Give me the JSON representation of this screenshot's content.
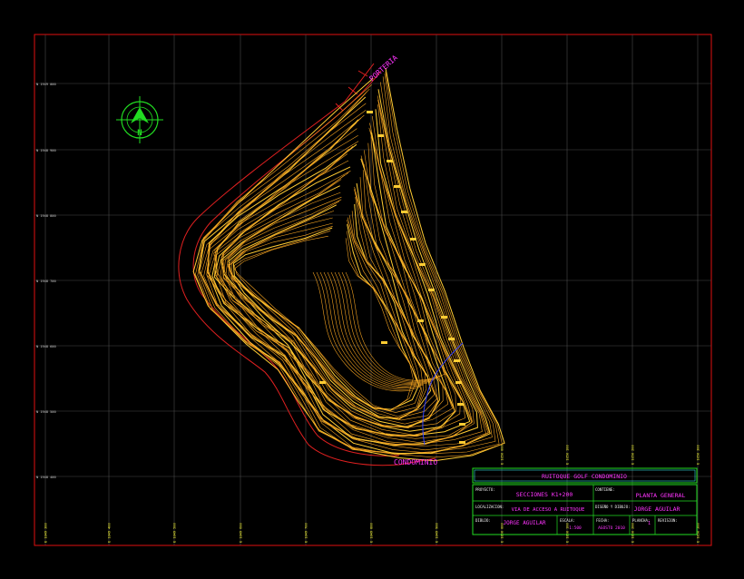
{
  "north_arrow": {
    "label": "N"
  },
  "grid_labels": {
    "left": [
      "N 1949 000",
      "N 1948 900",
      "N 1948 800",
      "N 1948 700",
      "N 1948 600",
      "N 1948 500",
      "N 1948 400"
    ],
    "bottom": [
      "E 1049 300",
      "E 1049 400",
      "E 1049 500",
      "E 1049 600",
      "E 1049 700",
      "E 1049 800",
      "E 1049 900",
      "E 1050 000",
      "E 1050 100",
      "E 1050 200",
      "E 1050 300"
    ]
  },
  "annotations": {
    "portal_top": "PORTERIA",
    "portal_bottom": "CONDOMINIO"
  },
  "title_block": {
    "header": "RUITOQUE GOLF CONDOMINIO",
    "row1": {
      "label_a": "PROYECTO:",
      "value_a": "SECCIONES K1+200",
      "label_b": "CONTIENE:",
      "value_b": "PLANTA GENERAL"
    },
    "row2": {
      "label_a": "LOCALIZACION:",
      "value_a": "VIA DE ACCESO A RUITOQUE",
      "label_b": "DISEÑO Y DIBUJO:",
      "value_b": "JORGE AGUILAR"
    },
    "row3": {
      "label_a": "DIBUJO:",
      "value_a": "JORGE AGUILAR",
      "label_b": "ESCALA:",
      "value_b": "1:500",
      "label_c": "FECHA:",
      "value_c": "AGOSTO 2010",
      "label_d": "PLANCHA:",
      "value_d": "1",
      "label_e": "REVISION:",
      "value_e": ""
    }
  },
  "colors": {
    "frame": "#e01010",
    "grid": "#4a4a4a",
    "contour": "#f0a020",
    "contour_major": "#ffcc33",
    "boundary": "#e02020",
    "north": "#22dd22",
    "label_magenta": "#ff33ff",
    "tb_green": "#22dd22",
    "tb_cyan": "#33dddd",
    "tb_magenta": "#ff33ff",
    "tb_yellow": "#ffff33",
    "tb_white": "#eeeeee",
    "stream": "#3344ff"
  }
}
